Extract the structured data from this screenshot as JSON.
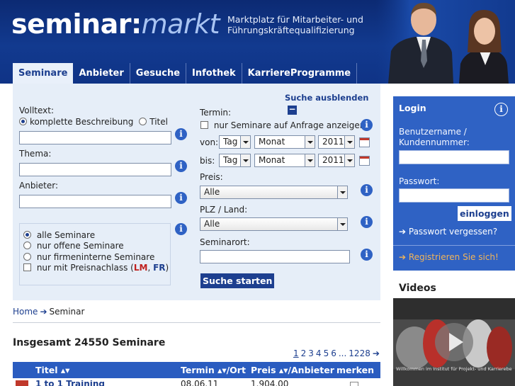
{
  "header": {
    "logo_part1": "seminar:",
    "logo_part2": "markt",
    "tagline": "Marktplatz für Mitarbeiter- und Führungskräftequalifizierung"
  },
  "tabs": [
    {
      "label": "Seminare",
      "active": true
    },
    {
      "label": "Anbieter",
      "active": false
    },
    {
      "label": "Gesuche",
      "active": false
    },
    {
      "label": "Infothek",
      "active": false
    },
    {
      "label": "KarriereProgramme",
      "active": false
    }
  ],
  "search": {
    "hide_label": "Suche ausblenden",
    "volltext_label": "Volltext:",
    "volltext_options": [
      "komplette Beschreibung",
      "Titel"
    ],
    "thema_label": "Thema:",
    "anbieter_label": "Anbieter:",
    "seminar_type_options": [
      "alle Seminare",
      "nur offene Seminare",
      "nur firmeninterne Seminare"
    ],
    "discount_label": "nur mit Preisnachlass (",
    "discount_lm": "LM",
    "discount_sep": ", ",
    "discount_fr": "FR",
    "discount_end": ")",
    "termin_label": "Termin:",
    "termin_checkbox": "nur Seminare auf Anfrage anzeigen",
    "von_label": "von:",
    "bis_label": "bis:",
    "day_value": "Tag",
    "month_value": "Monat",
    "year_value": "2011",
    "preis_label": "Preis:",
    "preis_value": "Alle",
    "plz_label": "PLZ / Land:",
    "plz_value": "Alle",
    "ort_label": "Seminarort:",
    "start_button": "Suche starten",
    "info_glyph": "i"
  },
  "breadcrumb": {
    "home": "Home",
    "current": "Seminar",
    "arrow": "➔"
  },
  "results": {
    "total_label": "Insgesamt 24550 Seminare",
    "pages": [
      "1",
      "2",
      "3",
      "4",
      "5",
      "6",
      "...",
      "1228",
      "➔"
    ],
    "columns": {
      "title": "Titel ▴▾",
      "termin": "Termin ▴▾/Ort",
      "preis": "Preis ▴▾/Anbieter",
      "merken": "merken"
    },
    "first_row": {
      "title": "1 to 1 Training",
      "date": "08.06.11",
      "price": "1.904,00"
    }
  },
  "login": {
    "title": "Login",
    "user_label": "Benutzername / Kundennummer:",
    "password_label": "Passwort:",
    "login_button": "einloggen",
    "forgot": "➔ Passwort vergessen?",
    "register": "➔ Registrieren Sie sich!",
    "info_glyph": "i"
  },
  "videos": {
    "title": "Videos",
    "caption": "Willkommen im Institut für Projekt- und Karriereberatung"
  },
  "colors": {
    "header": "#0c2a73",
    "accent": "#2f62c4",
    "search_bg": "#e6eef8",
    "register": "#f0b45a"
  }
}
